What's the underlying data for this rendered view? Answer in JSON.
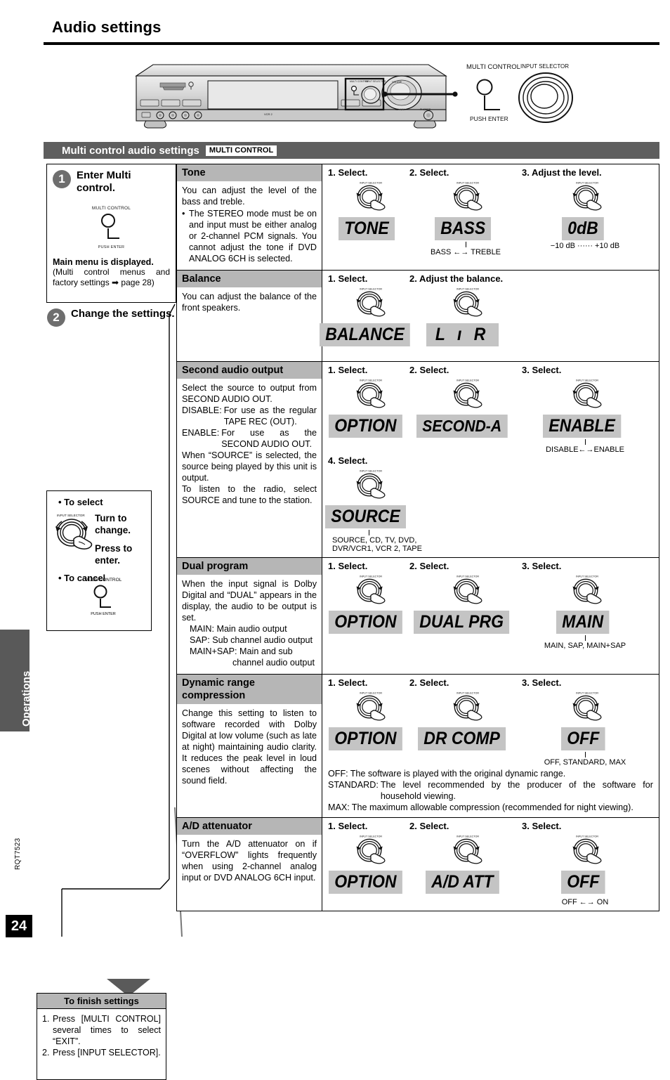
{
  "page": {
    "title": "Audio settings",
    "side_tab": "Operations",
    "doc_code": "RQT7523",
    "page_number": "24"
  },
  "unit_diagram": {
    "multi_control_label": "MULTI CONTROL",
    "input_selector_label": "INPUT SELECTOR",
    "push_enter_label": "PUSH ENTER"
  },
  "section": {
    "title": "Multi control audio settings",
    "tag": "MULTI CONTROL"
  },
  "left": {
    "step1": {
      "num": "1",
      "title": "Enter Multi control.",
      "knob_label": "MULTI CONTROL",
      "knob_sub": "PUSH ENTER",
      "result_bold": "Main menu is displayed.",
      "result_text": "(Multi control menus and factory settings ➡ page 28)"
    },
    "step2": {
      "num": "2",
      "title": "Change the settings."
    },
    "howto": {
      "select_bullet": "• To select",
      "turn": "Turn to change.",
      "press": "Press to enter.",
      "dial_label": "INPUT SELECTOR",
      "cancel_bullet": "• To cancel",
      "knob_label": "MULTI CONTROL",
      "knob_sub": "PUSH ENTER"
    },
    "finish": {
      "heading": "To finish settings",
      "items": [
        {
          "n": "1.",
          "t": "Press [MULTI CONTROL] several times to select “EXIT”."
        },
        {
          "n": "2.",
          "t": "Press [INPUT SELECTOR]."
        }
      ]
    }
  },
  "dial_label": "INPUT SELECTOR",
  "rows": [
    {
      "name": "tone",
      "heading": "Tone",
      "body": {
        "p1": "You can adjust the level of the bass and treble.",
        "bullet1": "The STEREO mode must be on and input must be either analog or 2-channel PCM signals. You cannot adjust the tone if DVD ANALOG 6CH is selected."
      },
      "steps": [
        {
          "label": "1. Select.",
          "lcd": "TONE",
          "caption": ""
        },
        {
          "label": "2. Select.",
          "lcd": "BASS",
          "caption": "BASS ←→ TREBLE"
        },
        {
          "label": "3. Adjust the level.",
          "lcd": "0dB",
          "caption": "−10 dB ······ +10 dB"
        }
      ]
    },
    {
      "name": "balance",
      "heading": "Balance",
      "body": {
        "p1": "You can adjust the balance of the front speakers."
      },
      "steps": [
        {
          "label": "1. Select.",
          "lcd": "BALANCE",
          "caption": ""
        },
        {
          "label": "2. Adjust the balance.",
          "lcd": "L  ı  R",
          "caption": ""
        }
      ]
    },
    {
      "name": "second-audio-output",
      "heading": "Second audio output",
      "body": {
        "p1": "Select the source to output from SECOND AUDIO OUT.",
        "d1k": "DISABLE:",
        "d1v": "For use as the regular TAPE REC (OUT).",
        "d2k": "ENABLE:",
        "d2v": "For use as the SECOND AUDIO OUT.",
        "p2": "When “SOURCE” is selected, the source being played by this unit is output.",
        "p3": "To listen to the radio, select SOURCE and tune to the station."
      },
      "steps": [
        {
          "label": "1. Select.",
          "lcd": "OPTION",
          "caption": ""
        },
        {
          "label": "2. Select.",
          "lcd": "SECOND-A",
          "caption": ""
        },
        {
          "label": "3. Select.",
          "lcd": "ENABLE",
          "caption": "DISABLE←→ENABLE"
        }
      ],
      "step4": {
        "label": "4. Select.",
        "lcd": "SOURCE",
        "caption_line1": "SOURCE, CD, TV, DVD,",
        "caption_line2": "DVR/VCR1, VCR 2, TAPE"
      }
    },
    {
      "name": "dual-program",
      "heading": "Dual program",
      "body": {
        "p1": "When the input signal is Dolby Digital and “DUAL” appears in the display, the audio to be output is set.",
        "l1": "MAIN: Main audio output",
        "l2": "SAP: Sub channel audio output",
        "l3": "MAIN+SAP: Main and sub",
        "l4": "channel audio output"
      },
      "steps": [
        {
          "label": "1. Select.",
          "lcd": "OPTION",
          "caption": ""
        },
        {
          "label": "2. Select.",
          "lcd": "DUAL PRG",
          "caption": ""
        },
        {
          "label": "3. Select.",
          "lcd": "MAIN",
          "caption": "MAIN, SAP, MAIN+SAP"
        }
      ]
    },
    {
      "name": "dynamic-range-compression",
      "heading": "Dynamic range compression",
      "body": {
        "p1": "Change this setting to listen to software recorded with Dolby Digital at low volume (such as late at night) maintaining audio clarity. It reduces the peak level in loud scenes without affecting the sound field."
      },
      "steps": [
        {
          "label": "1. Select.",
          "lcd": "OPTION",
          "caption": ""
        },
        {
          "label": "2. Select.",
          "lcd": "DR COMP",
          "caption": ""
        },
        {
          "label": "3. Select.",
          "lcd": "OFF",
          "caption": "OFF, STANDARD, MAX"
        }
      ],
      "notes": [
        {
          "k": "OFF:",
          "v": "The software is played with the original dynamic range."
        },
        {
          "k": "STANDARD:",
          "v": "The level recommended by the producer of the software for household viewing."
        },
        {
          "k": "MAX:",
          "v": "The maximum allowable compression (recommended for night viewing)."
        }
      ]
    },
    {
      "name": "ad-attenuator",
      "heading": "A/D attenuator",
      "body": {
        "p1": "Turn the A/D attenuator on if “OVERFLOW” lights frequently when using 2-channel analog input or DVD ANALOG 6CH input."
      },
      "steps": [
        {
          "label": "1. Select.",
          "lcd": "OPTION",
          "caption": ""
        },
        {
          "label": "2. Select.",
          "lcd": "A/D ATT",
          "caption": ""
        },
        {
          "label": "3. Select.",
          "lcd": "OFF",
          "caption": "OFF ←→ ON"
        }
      ]
    }
  ],
  "colors": {
    "section_bar": "#5e5e5e",
    "heading_grey": "#b6b6b6",
    "lcd_grey": "#c4c4c4",
    "side_tab": "#595959"
  }
}
